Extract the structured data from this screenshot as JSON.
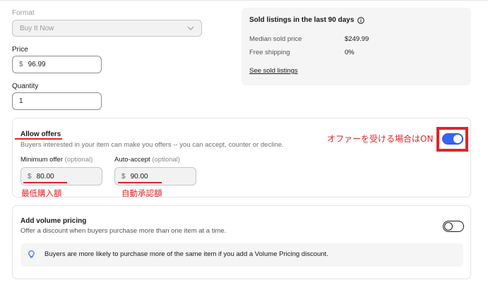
{
  "format": {
    "label": "Format",
    "value": "Buy It Now"
  },
  "price": {
    "label": "Price",
    "currency": "$",
    "value": "96.99"
  },
  "quantity": {
    "label": "Quantity",
    "value": "1"
  },
  "sold_listings": {
    "title": "Sold listings in the last 90 days",
    "rows": [
      {
        "label": "Median sold price",
        "value": "$249.99"
      },
      {
        "label": "Free shipping",
        "value": "0%"
      }
    ],
    "link": "See sold listings"
  },
  "allow_offers": {
    "title": "Allow offers",
    "description": "Buyers interested in your item can make you offers -- you can accept, counter or decline.",
    "enabled": true,
    "minimum_offer": {
      "label": "Minimum offer",
      "optional": "(optional)",
      "currency": "$",
      "value": "80.00"
    },
    "auto_accept": {
      "label": "Auto-accept",
      "optional": "(optional)",
      "currency": "$",
      "value": "90.00"
    }
  },
  "annotations": {
    "toggle_note": "オファーを受ける場合はON",
    "minimum_note": "最低購入額",
    "auto_accept_note": "自動承認額"
  },
  "volume_pricing": {
    "title": "Add volume pricing",
    "description": "Offer a discount when buyers purchase more than one item at a time.",
    "enabled": false,
    "tip": "Buyers are more likely to purchase more of the same item if you add a Volume Pricing discount."
  },
  "colors": {
    "toggle_on": "#3665f3",
    "annotation_red": "#e0252a"
  },
  "icons": {
    "format_dropdown": "chevron-down-icon",
    "sold_info": "info-icon",
    "tip": "lightbulb-icon"
  }
}
